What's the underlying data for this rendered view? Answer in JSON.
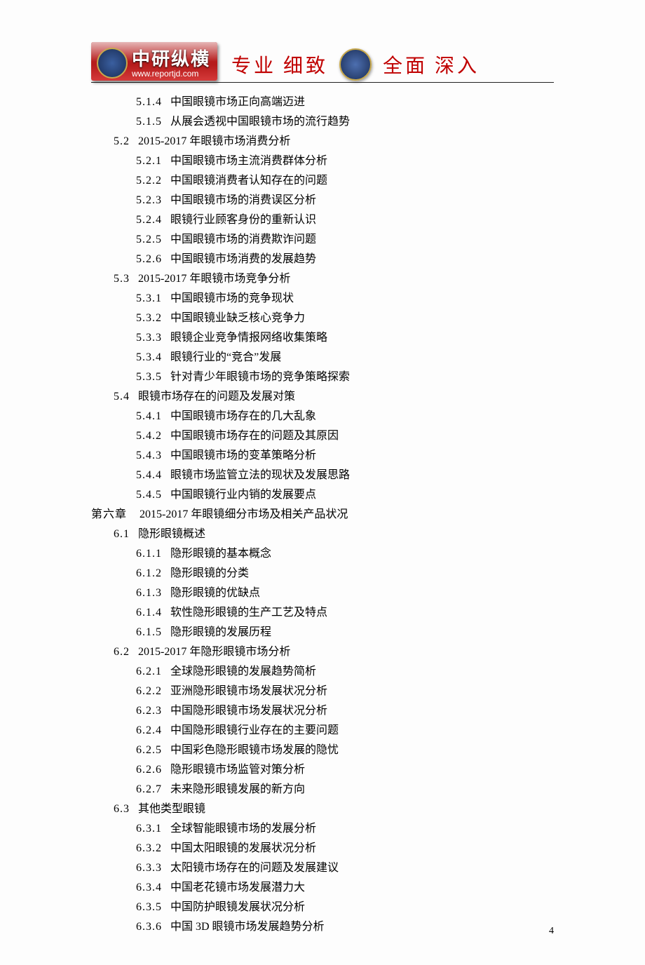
{
  "header": {
    "logo_main": "中研纵横",
    "logo_url": "www.reportjd.com",
    "slogan_parts": [
      "专业",
      "细致",
      "全面",
      "深入"
    ]
  },
  "page_number": "4",
  "toc": [
    {
      "level": "sub",
      "num": "5.1.4",
      "title": "中国眼镜市场正向高端迈进"
    },
    {
      "level": "sub",
      "num": "5.1.5",
      "title": "从展会透视中国眼镜市场的流行趋势"
    },
    {
      "level": "sec",
      "num": "5.2",
      "title": "2015-2017 年眼镜市场消费分析"
    },
    {
      "level": "sub",
      "num": "5.2.1",
      "title": "中国眼镜市场主流消费群体分析"
    },
    {
      "level": "sub",
      "num": "5.2.2",
      "title": "中国眼镜消费者认知存在的问题"
    },
    {
      "level": "sub",
      "num": "5.2.3",
      "title": "中国眼镜市场的消费误区分析"
    },
    {
      "level": "sub",
      "num": "5.2.4",
      "title": "眼镜行业顾客身份的重新认识"
    },
    {
      "level": "sub",
      "num": "5.2.5",
      "title": "中国眼镜市场的消费欺诈问题"
    },
    {
      "level": "sub",
      "num": "5.2.6",
      "title": "中国眼镜市场消费的发展趋势"
    },
    {
      "level": "sec",
      "num": "5.3",
      "title": "2015-2017 年眼镜市场竞争分析"
    },
    {
      "level": "sub",
      "num": "5.3.1",
      "title": "中国眼镜市场的竞争现状"
    },
    {
      "level": "sub",
      "num": "5.3.2",
      "title": "中国眼镜业缺乏核心竞争力"
    },
    {
      "level": "sub",
      "num": "5.3.3",
      "title": "眼镜企业竞争情报网络收集策略"
    },
    {
      "level": "sub",
      "num": "5.3.4",
      "title": "眼镜行业的“竞合”发展"
    },
    {
      "level": "sub",
      "num": "5.3.5",
      "title": "针对青少年眼镜市场的竞争策略探索"
    },
    {
      "level": "sec",
      "num": "5.4",
      "title": "眼镜市场存在的问题及发展对策"
    },
    {
      "level": "sub",
      "num": "5.4.1",
      "title": "中国眼镜市场存在的几大乱象"
    },
    {
      "level": "sub",
      "num": "5.4.2",
      "title": "中国眼镜市场存在的问题及其原因"
    },
    {
      "level": "sub",
      "num": "5.4.3",
      "title": "中国眼镜市场的变革策略分析"
    },
    {
      "level": "sub",
      "num": "5.4.4",
      "title": "眼镜市场监管立法的现状及发展思路"
    },
    {
      "level": "sub",
      "num": "5.4.5",
      "title": "中国眼镜行业内销的发展要点"
    },
    {
      "level": "chapter",
      "num": "第六章",
      "title": "2015-2017 年眼镜细分市场及相关产品状况"
    },
    {
      "level": "sec",
      "num": "6.1",
      "title": "隐形眼镜概述"
    },
    {
      "level": "sub",
      "num": "6.1.1",
      "title": "隐形眼镜的基本概念"
    },
    {
      "level": "sub",
      "num": "6.1.2",
      "title": "隐形眼镜的分类"
    },
    {
      "level": "sub",
      "num": "6.1.3",
      "title": "隐形眼镜的优缺点"
    },
    {
      "level": "sub",
      "num": "6.1.4",
      "title": "软性隐形眼镜的生产工艺及特点"
    },
    {
      "level": "sub",
      "num": "6.1.5",
      "title": "隐形眼镜的发展历程"
    },
    {
      "level": "sec",
      "num": "6.2",
      "title": "2015-2017 年隐形眼镜市场分析"
    },
    {
      "level": "sub",
      "num": "6.2.1",
      "title": "全球隐形眼镜的发展趋势简析"
    },
    {
      "level": "sub",
      "num": "6.2.2",
      "title": "亚洲隐形眼镜市场发展状况分析"
    },
    {
      "level": "sub",
      "num": "6.2.3",
      "title": "中国隐形眼镜市场发展状况分析"
    },
    {
      "level": "sub",
      "num": "6.2.4",
      "title": "中国隐形眼镜行业存在的主要问题"
    },
    {
      "level": "sub",
      "num": "6.2.5",
      "title": "中国彩色隐形眼镜市场发展的隐忧"
    },
    {
      "level": "sub",
      "num": "6.2.6",
      "title": "隐形眼镜市场监管对策分析"
    },
    {
      "level": "sub",
      "num": "6.2.7",
      "title": "未来隐形眼镜发展的新方向"
    },
    {
      "level": "sec",
      "num": "6.3",
      "title": "其他类型眼镜"
    },
    {
      "level": "sub",
      "num": "6.3.1",
      "title": "全球智能眼镜市场的发展分析"
    },
    {
      "level": "sub",
      "num": "6.3.2",
      "title": "中国太阳眼镜的发展状况分析"
    },
    {
      "level": "sub",
      "num": "6.3.3",
      "title": "太阳镜市场存在的问题及发展建议"
    },
    {
      "level": "sub",
      "num": "6.3.4",
      "title": "中国老花镜市场发展潜力大"
    },
    {
      "level": "sub",
      "num": "6.3.5",
      "title": "中国防护眼镜发展状况分析"
    },
    {
      "level": "sub",
      "num": "6.3.6",
      "title": "中国 3D 眼镜市场发展趋势分析"
    }
  ]
}
